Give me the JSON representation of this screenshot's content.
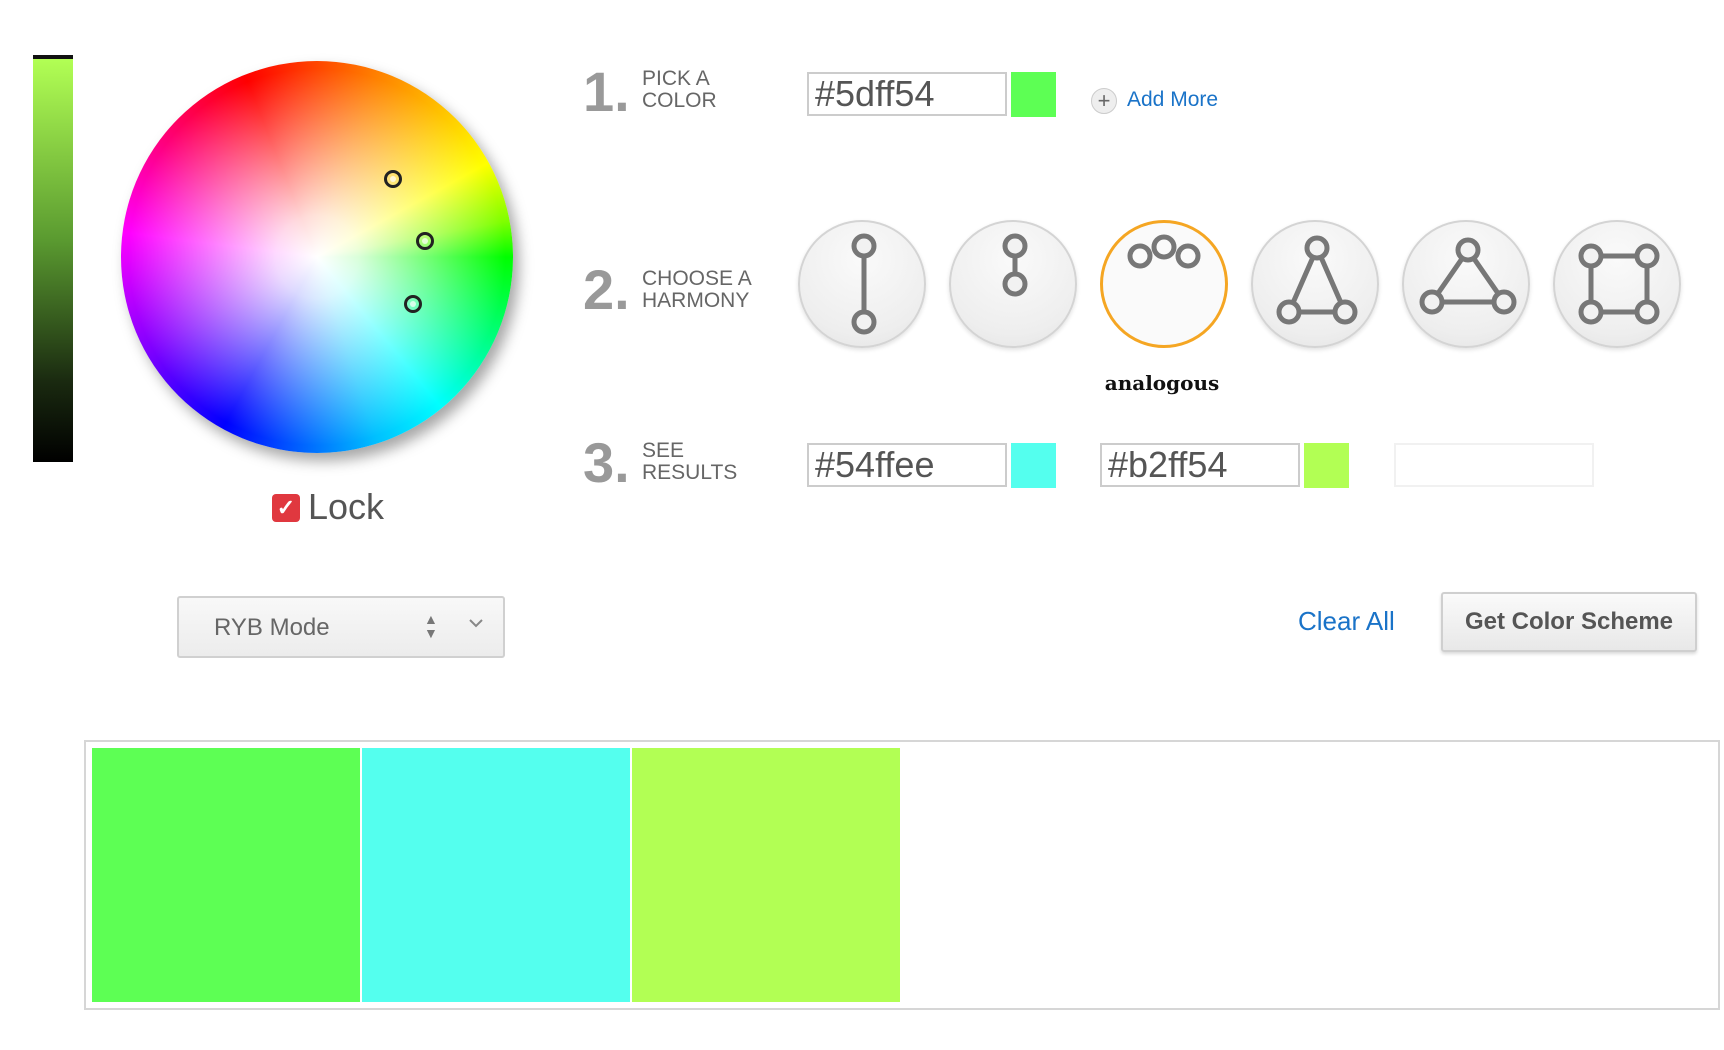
{
  "wheel": {
    "lock_label": "Lock",
    "markers": [
      {
        "hex": "#5dff54"
      },
      {
        "hex": "#b2ff54"
      },
      {
        "hex": "#54ffee"
      }
    ]
  },
  "value_bar": {
    "top_color": "#b2ff54",
    "bottom_color": "#000000"
  },
  "steps": {
    "pick": {
      "number": "1.",
      "label_line1": "PICK A",
      "label_line2": "COLOR",
      "hex": "#5dff54",
      "swatch": "#5dff54",
      "add_more": "Add More"
    },
    "harmony": {
      "number": "2.",
      "label_line1": "CHOOSE A",
      "label_line2": "HARMONY",
      "options": [
        "complementary-line-icon",
        "short-line-icon",
        "analogous-icon",
        "triangle-icon",
        "wide-triangle-icon",
        "square-icon"
      ],
      "selected_index": 2,
      "selected_caption": "analogous"
    },
    "results": {
      "number": "3.",
      "label_line1": "SEE",
      "label_line2": "RESULTS",
      "colors": [
        {
          "hex": "#54ffee",
          "swatch": "#54ffee"
        },
        {
          "hex": "#b2ff54",
          "swatch": "#b2ff54"
        }
      ],
      "empty_slot": ""
    }
  },
  "mode_select": {
    "value": "RYB Mode"
  },
  "actions": {
    "clear_all": "Clear All",
    "get_scheme": "Get Color Scheme"
  },
  "palette": [
    "#5dff54",
    "#54ffee",
    "#b2ff54"
  ],
  "colors": {
    "link": "#1a73c8",
    "selected_ring": "#f5a623",
    "lock_red": "#e0383f"
  }
}
